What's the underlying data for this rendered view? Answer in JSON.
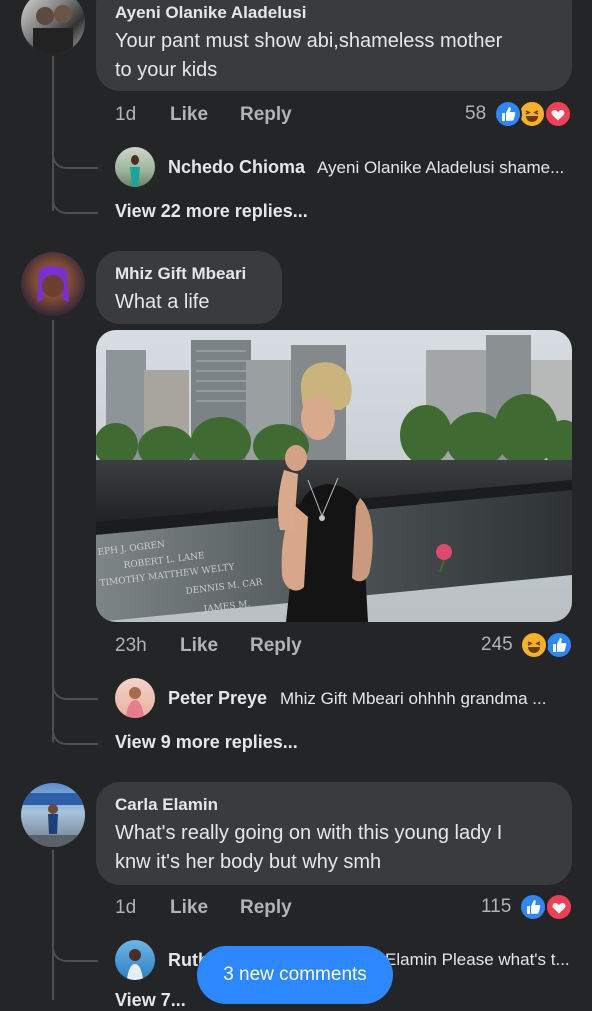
{
  "comments": [
    {
      "author": "Ayeni Olanike Aladelusi",
      "text_lines": [
        "Your pant must show abi,shameless mother",
        "to your kids"
      ],
      "time": "1d",
      "like": "Like",
      "reply": "Reply",
      "reaction_count": "58",
      "reactions": [
        "like-icon",
        "haha-icon",
        "love-icon"
      ],
      "reply_preview": {
        "author": "Nchedo Chioma",
        "text": "Ayeni Olanike Aladelusi shame..."
      },
      "more_replies": "View 22 more replies..."
    },
    {
      "author": "Mhiz Gift Mbeari",
      "text_lines": [
        "What a life"
      ],
      "time": "23h",
      "like": "Like",
      "reply": "Reply",
      "reaction_count": "245",
      "reactions": [
        "haha-icon",
        "like-icon"
      ],
      "reply_preview": {
        "author": "Peter Preye",
        "text": "Mhiz Gift Mbeari  ohhhh grandma ..."
      },
      "more_replies": "View 9 more replies..."
    },
    {
      "author": "Carla Elamin",
      "text_lines": [
        "What's really going on  with this young lady I",
        "knw it's her body but why smh"
      ],
      "time": "1d",
      "like": "Like",
      "reply": "Reply",
      "reaction_count": "115",
      "reactions": [
        "like-icon",
        "love-icon"
      ],
      "reply_preview": {
        "author": "Ruth",
        "text": "Elamin Please what's t..."
      },
      "more_replies": "View 7..."
    }
  ],
  "memorial_names": [
    "EPH J. OGREN",
    "ROBERT L. LANE",
    "TIMOTHY MATTHEW WELTY",
    "DENNIS M. CAR",
    "JAMES M."
  ],
  "new_comments_button": "3 new comments",
  "colors": {
    "background": "#242526",
    "bubble": "#3a3b3c",
    "accent": "#2d88ff",
    "love": "#f33e58",
    "haha": "#f7b125"
  }
}
